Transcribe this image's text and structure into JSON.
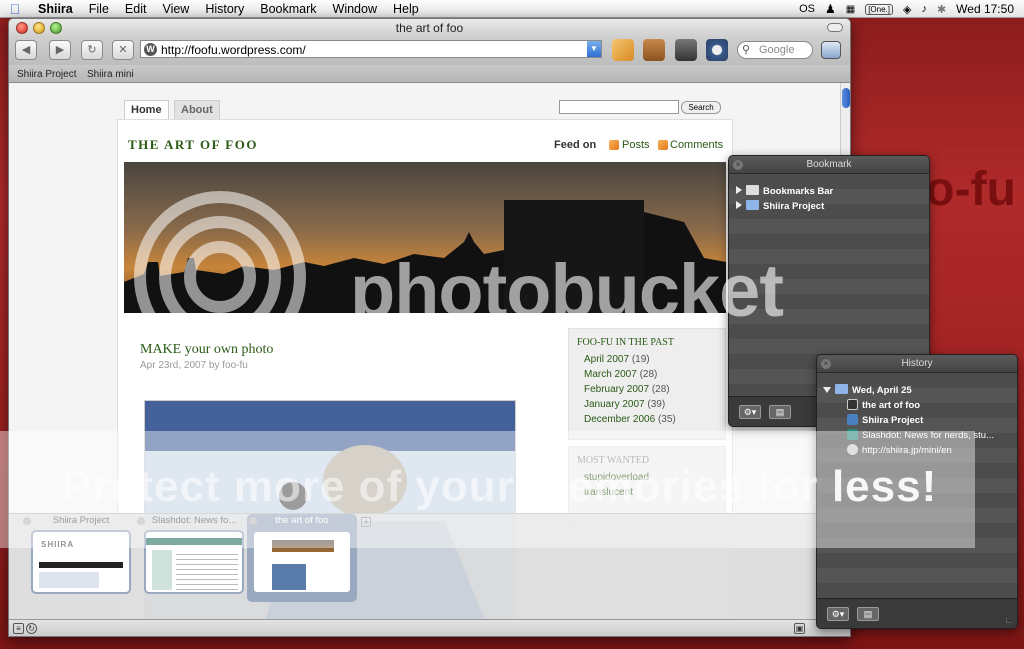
{
  "menubar": {
    "app": "Shiira",
    "items": [
      "File",
      "Edit",
      "View",
      "History",
      "Bookmark",
      "Window",
      "Help"
    ],
    "right": {
      "os_label": "OS",
      "one_label": "[One.]",
      "clock": "Wed 17:50"
    }
  },
  "desktop": {
    "bg_text": "foo-fu"
  },
  "window": {
    "title": "the art of foo",
    "address": "http://foofu.wordpress.com/",
    "search_placeholder": "Google",
    "bookmarks_bar": [
      "Shiira Project",
      "Shiira mini"
    ]
  },
  "blog": {
    "nav": [
      "Home",
      "About"
    ],
    "search_button": "Search",
    "title": "THE ART OF FOO",
    "feed_on": "Feed on",
    "feeds": [
      "Posts",
      "Comments"
    ],
    "post": {
      "title": "MAKE your own photo",
      "meta": "Apr 23rd, 2007 by foo-fu"
    },
    "archive": {
      "heading": "FOO-FU IN THE PAST",
      "items": [
        {
          "month": "April 2007",
          "count": "(19)"
        },
        {
          "month": "March 2007",
          "count": "(28)"
        },
        {
          "month": "February 2007",
          "count": "(28)"
        },
        {
          "month": "January 2007",
          "count": "(39)"
        },
        {
          "month": "December 2006",
          "count": "(35)"
        }
      ]
    },
    "most_wanted": {
      "heading": "MOST WANTED",
      "items": [
        "stupidoverload",
        "translucent"
      ]
    }
  },
  "tabs": [
    {
      "label": "Shiira Project",
      "selected": false
    },
    {
      "label": "Slashdot: News fo...",
      "selected": false
    },
    {
      "label": "the art of foo",
      "selected": true
    }
  ],
  "bookmark_panel": {
    "title": "Bookmark",
    "items": [
      "Bookmarks Bar",
      "Shiira Project"
    ]
  },
  "history_panel": {
    "title": "History",
    "group": "Wed, April 25",
    "items": [
      "the art of foo",
      "Shiira Project",
      "Slashdot: News for nerds, stu...",
      "http://shiira.jp/mini/en"
    ]
  },
  "watermark": {
    "brand": "photobucket",
    "slogan_parts": [
      "Protect more of your memories for ",
      "less!"
    ]
  },
  "colors": {
    "accent_green": "#2a5a16",
    "desktop_red": "#a02222",
    "hud_bg": "#3a3a3a"
  }
}
